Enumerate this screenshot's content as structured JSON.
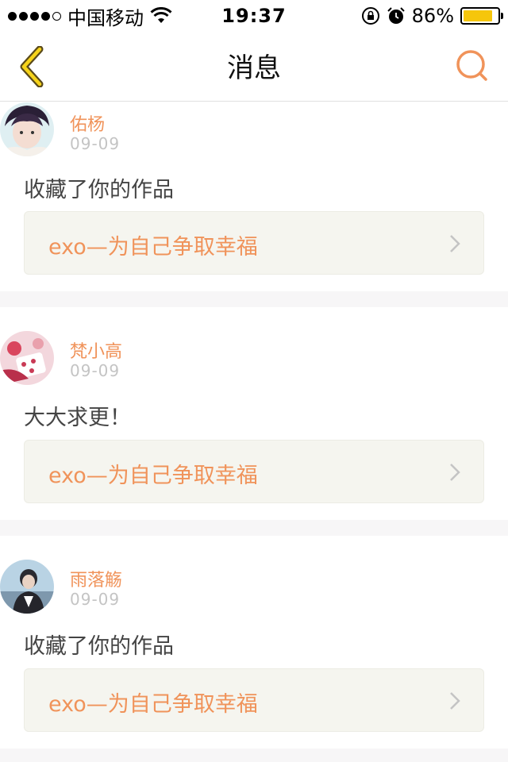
{
  "status_bar": {
    "carrier": "中国移动",
    "time": "19:37",
    "battery": "86%",
    "battery_level": 0.86,
    "battery_color": "#f6c60b"
  },
  "nav": {
    "title": "消息",
    "accent_color": "#f0935a"
  },
  "notifications": [
    {
      "user": "佑杨",
      "date": "09-09",
      "message": "收藏了你的作品",
      "work": "exo—为自己争取幸福"
    },
    {
      "user": "梵小高",
      "date": "09-09",
      "message": "大大求更！",
      "work": "exo—为自己争取幸福"
    },
    {
      "user": "雨落觞",
      "date": "09-09",
      "message": "收藏了你的作品",
      "work": "exo—为自己争取幸福"
    }
  ],
  "icons": {
    "back": "chevron-left-icon",
    "search": "search-icon",
    "wifi": "wifi-icon",
    "lock": "rotation-lock-icon",
    "alarm": "alarm-icon",
    "chevron": "chevron-right-icon"
  }
}
